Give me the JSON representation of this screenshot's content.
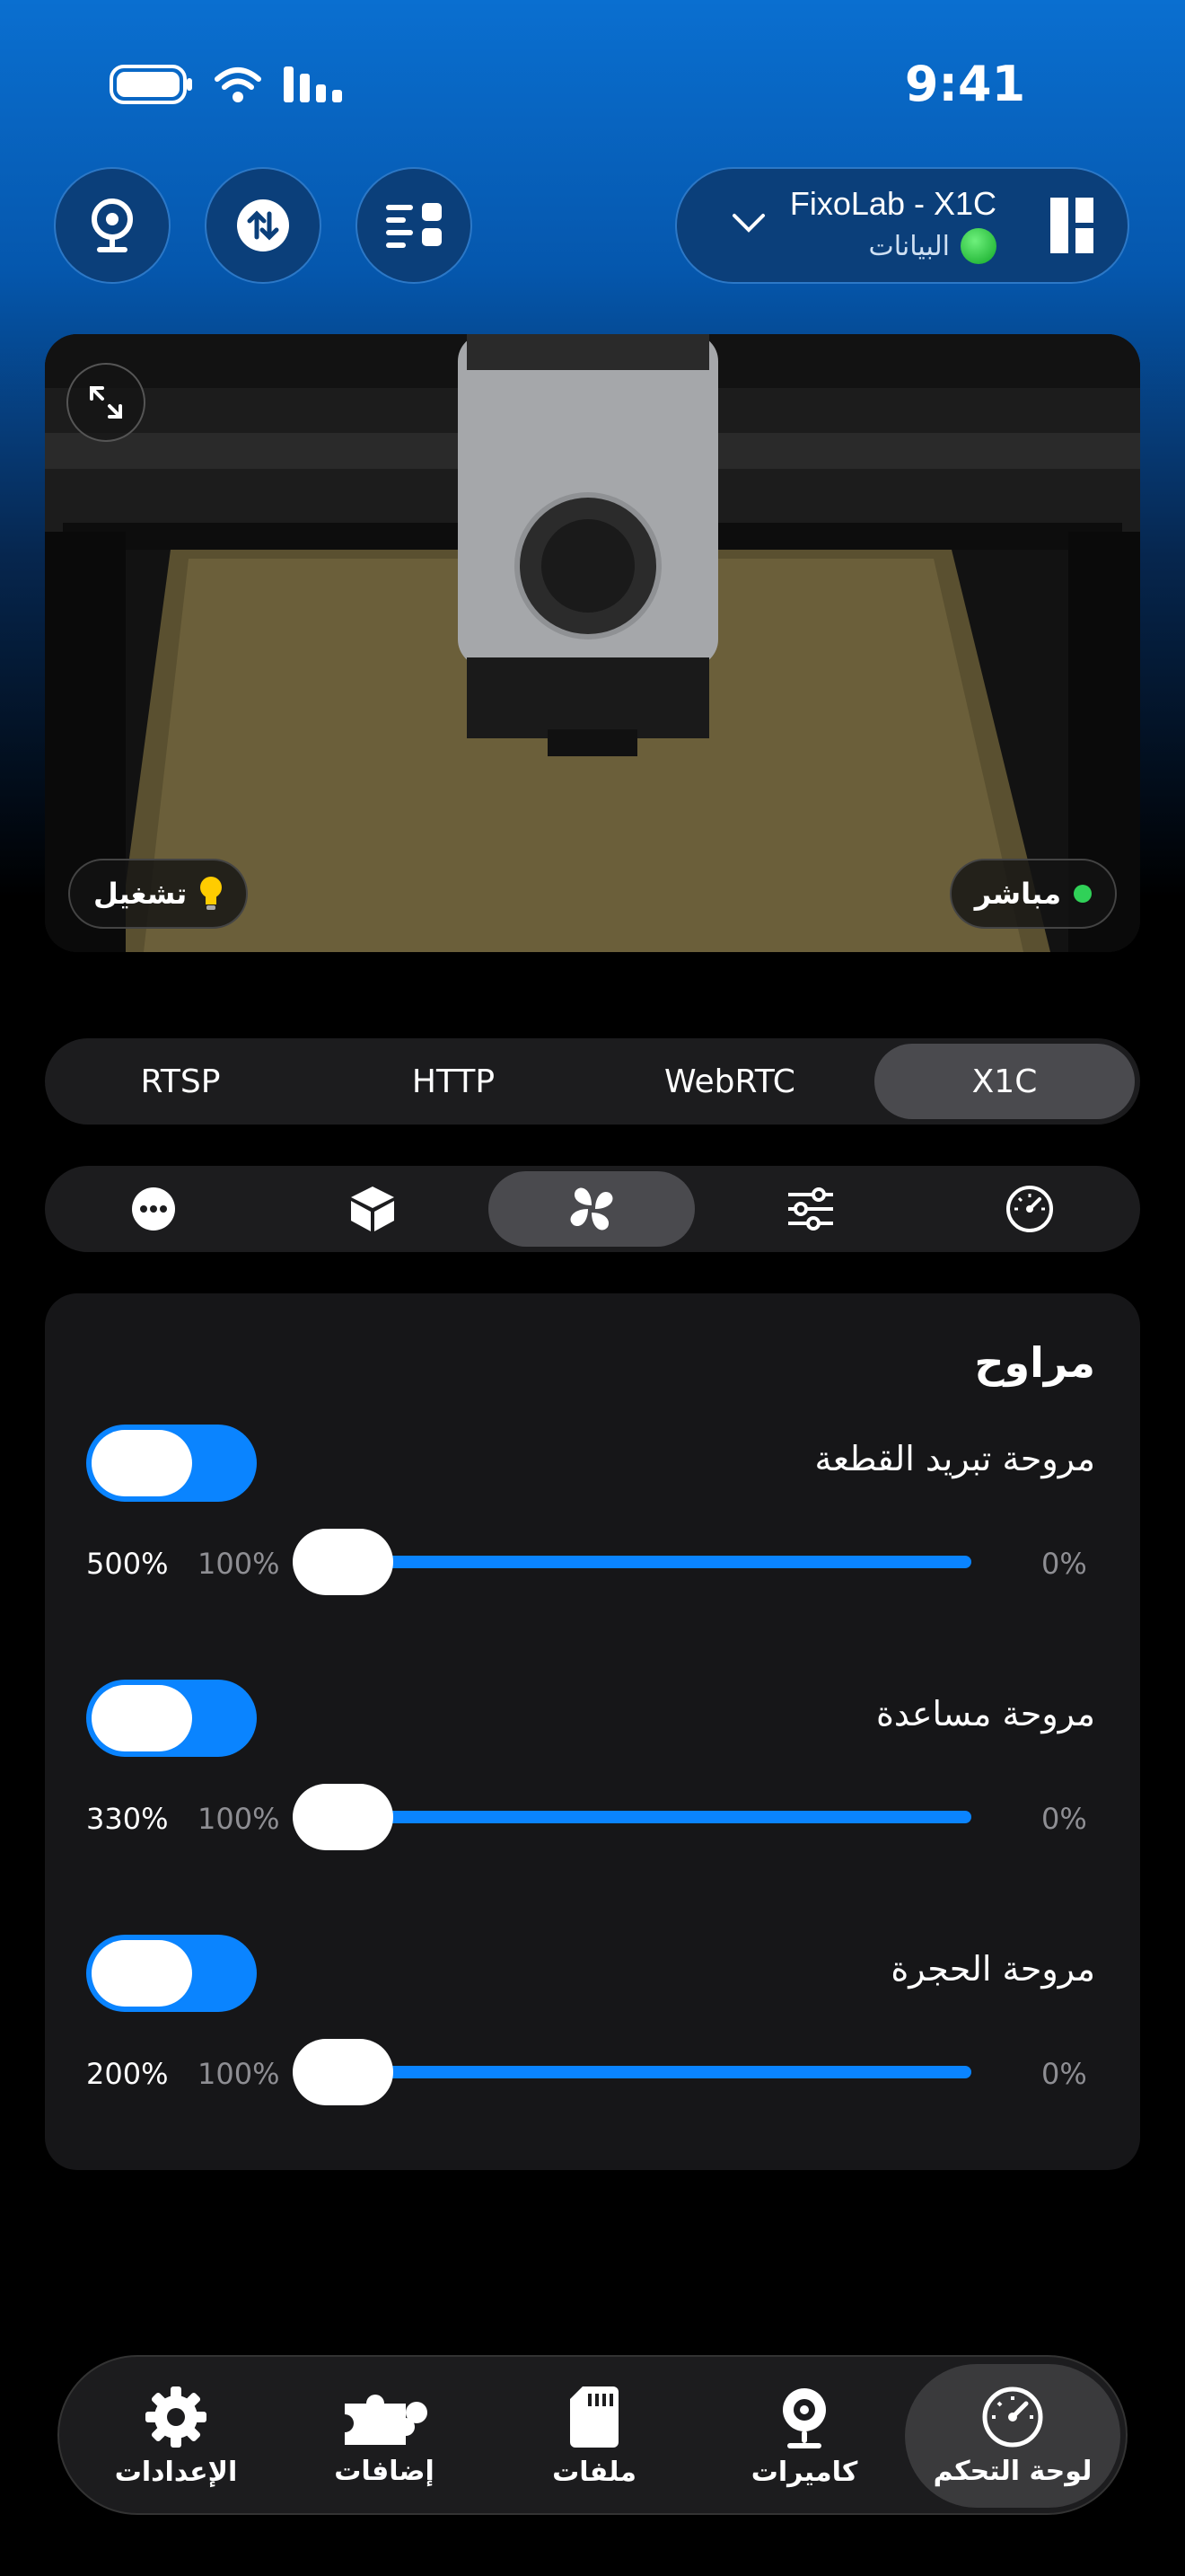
{
  "status": {
    "time": "9:41"
  },
  "header": {
    "printer_name": "FixoLab - X1C",
    "printer_status": "البيانات",
    "icons": [
      "webcam-icon",
      "transfer-icon",
      "list-icon",
      "printer-logo-icon",
      "chevron-down-icon"
    ]
  },
  "camera": {
    "live_label": "مباشر",
    "light_label": "تشغيل"
  },
  "stream_tabs": {
    "tabs": [
      "RTSP",
      "HTTP",
      "WebRTC",
      "X1C"
    ],
    "selected": "X1C"
  },
  "control_tabs": {
    "icons": [
      "more-icon",
      "box-icon",
      "fan-icon",
      "sliders-icon",
      "gauge-icon"
    ],
    "selected": "fan-icon"
  },
  "fans": {
    "title": "مراوح",
    "items": [
      {
        "label": "مروحة تبريد القطعة",
        "enabled": true,
        "max": "500%",
        "mid": "100%",
        "min": "0%",
        "level": 0
      },
      {
        "label": "مروحة مساعدة",
        "enabled": true,
        "max": "330%",
        "mid": "100%",
        "min": "0%",
        "level": 0
      },
      {
        "label": "مروحة الحجرة",
        "enabled": true,
        "max": "200%",
        "mid": "100%",
        "min": "0%",
        "level": 0
      }
    ]
  },
  "nav": {
    "items": [
      {
        "label": "الإعدادات",
        "icon": "gear-icon"
      },
      {
        "label": "إضافات",
        "icon": "puzzle-icon"
      },
      {
        "label": "ملفات",
        "icon": "sd-card-icon"
      },
      {
        "label": "كاميرات",
        "icon": "webcam-icon"
      },
      {
        "label": "لوحة التحكم",
        "icon": "gauge-icon"
      }
    ],
    "selected": "لوحة التحكم"
  },
  "colors": {
    "accent": "#0a84ff",
    "header_blue": "#0557ad",
    "card": "#161618"
  }
}
